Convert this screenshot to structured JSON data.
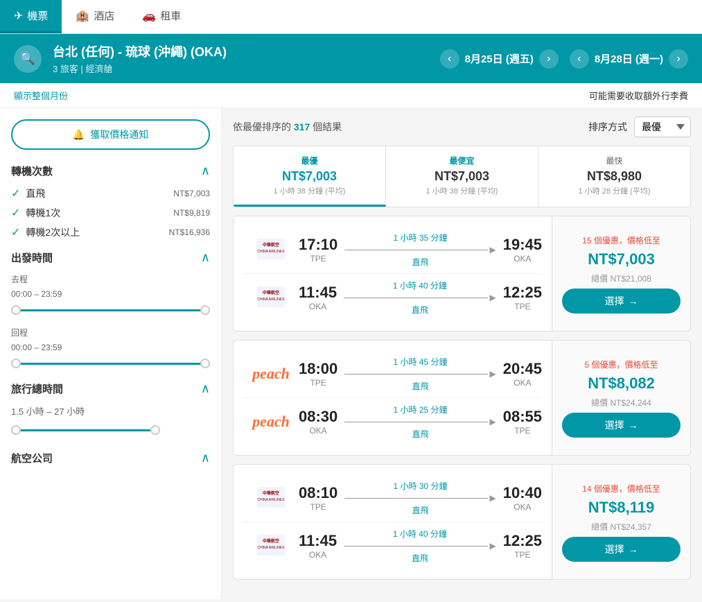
{
  "nav": {
    "tabs": [
      {
        "id": "flights",
        "label": "機票",
        "icon": "✈",
        "active": true
      },
      {
        "id": "hotels",
        "label": "酒店",
        "icon": "🏨",
        "active": false
      },
      {
        "id": "car",
        "label": "租車",
        "icon": "🚗",
        "active": false
      }
    ]
  },
  "header": {
    "route": "台北 (任何) - 琉球 (沖繩) (OKA)",
    "sub": "3 旅客 | 經濟艙",
    "date_left": "8月25日 (週五)",
    "date_right": "8月28日 (週一)"
  },
  "subheader": {
    "show_month": "顯示整個月份",
    "extra_fees": "可能需要收取額外行李費"
  },
  "sidebar": {
    "notify_btn": "獲取價格通知",
    "bell_icon": "🔔",
    "transfer": {
      "title": "轉機次數",
      "options": [
        {
          "label": "直飛",
          "price": "NT$7,003",
          "checked": true
        },
        {
          "label": "轉機1次",
          "price": "NT$9,819",
          "checked": true
        },
        {
          "label": "轉機2次以上",
          "price": "NT$16,936",
          "checked": true
        }
      ]
    },
    "departure_time": {
      "title": "出發時間",
      "outbound_label": "去程",
      "outbound_range": "00:00 – 23:59",
      "return_label": "回程",
      "return_range": "00:00 – 23:59"
    },
    "travel_time": {
      "title": "旅行總時間",
      "range": "1.5 小時 – 27 小時"
    },
    "airlines": {
      "title": "航空公司"
    }
  },
  "results": {
    "sort_label": "排序方式",
    "sort_option": "最優",
    "count_prefix": "依最優排序的",
    "count": "317",
    "count_suffix": "個結果",
    "price_tabs": [
      {
        "label": "最優",
        "price": "NT$7,003",
        "sub": "1 小時 38 分鐘 (平均)",
        "active": true,
        "label_class": "best"
      },
      {
        "label": "最便宜",
        "price": "NT$7,003",
        "sub": "1 小時 38 分鐘 (平均)",
        "active": false,
        "label_class": "best"
      },
      {
        "label": "最快",
        "price": "NT$8,980",
        "sub": "1 小時 28 分鐘 (平均)",
        "active": false,
        "label_class": ""
      }
    ],
    "cards": [
      {
        "id": 1,
        "promo": "15 個優惠，價格低至",
        "price": "NT$7,003",
        "total": "總價 NT$21,008",
        "select": "選擇",
        "flights": [
          {
            "airline": "china_airlines",
            "depart_time": "17:10",
            "depart_airport": "TPE",
            "duration": "1 小時 35 分鐘",
            "direct": "直飛",
            "arrive_time": "19:45",
            "arrive_airport": "OKA"
          },
          {
            "airline": "china_airlines",
            "depart_time": "11:45",
            "depart_airport": "OKA",
            "duration": "1 小時 40 分鐘",
            "direct": "直飛",
            "arrive_time": "12:25",
            "arrive_airport": "TPE"
          }
        ]
      },
      {
        "id": 2,
        "promo": "5 個優惠，價格低至",
        "price": "NT$8,082",
        "total": "總價 NT$24,244",
        "select": "選擇",
        "flights": [
          {
            "airline": "peach",
            "depart_time": "18:00",
            "depart_airport": "TPE",
            "duration": "1 小時 45 分鐘",
            "direct": "直飛",
            "arrive_time": "20:45",
            "arrive_airport": "OKA"
          },
          {
            "airline": "peach",
            "depart_time": "08:30",
            "depart_airport": "OKA",
            "duration": "1 小時 25 分鐘",
            "direct": "直飛",
            "arrive_time": "08:55",
            "arrive_airport": "TPE"
          }
        ]
      },
      {
        "id": 3,
        "promo": "14 個優惠，價格低至",
        "price": "NT$8,119",
        "total": "總價 NT$24,357",
        "select": "選擇",
        "flights": [
          {
            "airline": "china_airlines",
            "depart_time": "08:10",
            "depart_airport": "TPE",
            "duration": "1 小時 30 分鐘",
            "direct": "直飛",
            "arrive_time": "10:40",
            "arrive_airport": "OKA"
          },
          {
            "airline": "china_airlines",
            "depart_time": "11:45",
            "depart_airport": "OKA",
            "duration": "1 小時 40 分鐘",
            "direct": "直飛",
            "arrive_time": "12:25",
            "arrive_airport": "TPE"
          }
        ]
      }
    ]
  },
  "colors": {
    "primary": "#0097a7",
    "accent": "#e74c3c",
    "peach_color": "#ff6b35"
  }
}
